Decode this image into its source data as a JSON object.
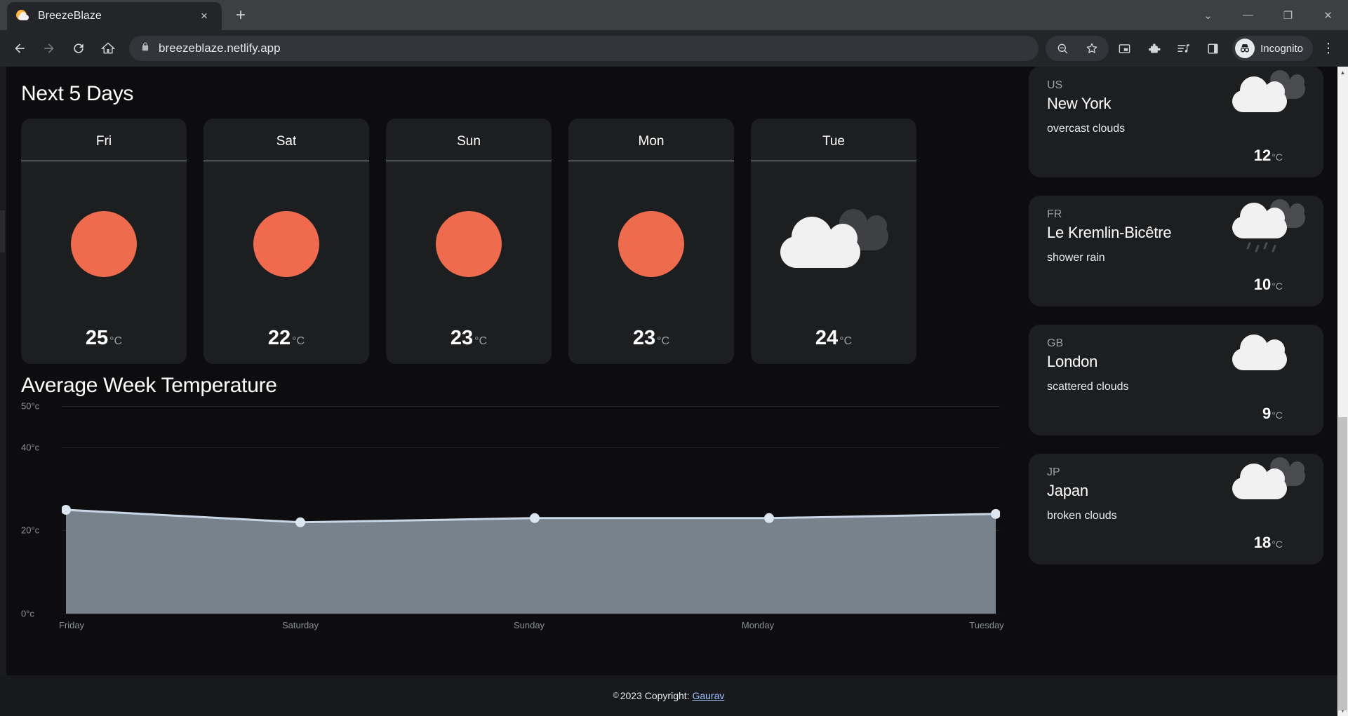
{
  "browser": {
    "tab": {
      "title": "BreezeBlaze",
      "favicon": "weather-sun-cloud-icon",
      "close": "×"
    },
    "new_tab_label": "+",
    "window_controls": {
      "minimize_group": "⌄",
      "minimize": "—",
      "restore": "❐",
      "close": "✕"
    },
    "toolbar": {
      "back": "←",
      "forward": "→",
      "reload": "⟳",
      "home": "⌂",
      "url": "breezeblaze.netlify.app",
      "lock": "lock-icon",
      "zoom_out": "zoom-out-icon",
      "bookmark": "star-icon",
      "picture_in_picture": "pip-icon",
      "extensions": "puzzle-icon",
      "media": "media-list-icon",
      "side_panel": "side-panel-icon",
      "profile_label": "Incognito",
      "menu": "⋮"
    }
  },
  "page": {
    "forecast": {
      "title": "Next 5 Days",
      "unit": "°C",
      "days": [
        {
          "day": "Fri",
          "temp": "25",
          "icon": "sun-icon"
        },
        {
          "day": "Sat",
          "temp": "22",
          "icon": "sun-icon"
        },
        {
          "day": "Sun",
          "temp": "23",
          "icon": "sun-icon"
        },
        {
          "day": "Mon",
          "temp": "23",
          "icon": "sun-icon"
        },
        {
          "day": "Tue",
          "temp": "24",
          "icon": "broken-clouds-icon"
        }
      ]
    },
    "cities": [
      {
        "code": "US",
        "name": "New York",
        "desc": "overcast clouds",
        "temp": "12",
        "unit": "°C",
        "icon": "overcast-clouds-icon"
      },
      {
        "code": "FR",
        "name": "Le Kremlin-Bicêtre",
        "desc": "shower rain",
        "temp": "10",
        "unit": "°C",
        "icon": "shower-rain-icon"
      },
      {
        "code": "GB",
        "name": "London",
        "desc": "scattered clouds",
        "temp": "9",
        "unit": "°C",
        "icon": "scattered-clouds-icon"
      },
      {
        "code": "JP",
        "name": "Japan",
        "desc": "broken clouds",
        "temp": "18",
        "unit": "°C",
        "icon": "broken-clouds-icon"
      }
    ],
    "footer": {
      "symbol": "©",
      "text": "2023 Copyright:",
      "link": "Gaurav"
    }
  },
  "chart_data": {
    "type": "area",
    "title": "Average Week Temperature",
    "xlabel": "",
    "ylabel": "",
    "categories": [
      "Friday",
      "Saturday",
      "Sunday",
      "Monday",
      "Tuesday"
    ],
    "values": [
      25,
      22,
      23,
      23,
      24
    ],
    "ytick_labels": [
      "50°c",
      "40°c",
      "20°c",
      "0°c"
    ],
    "ytick_values": [
      50,
      40,
      20,
      0
    ],
    "ylim": [
      0,
      50
    ],
    "grid": true,
    "legend": "none",
    "line_color": "#c8d6e5",
    "fill_color": "#78828d",
    "point_color": "#dce6f0"
  }
}
